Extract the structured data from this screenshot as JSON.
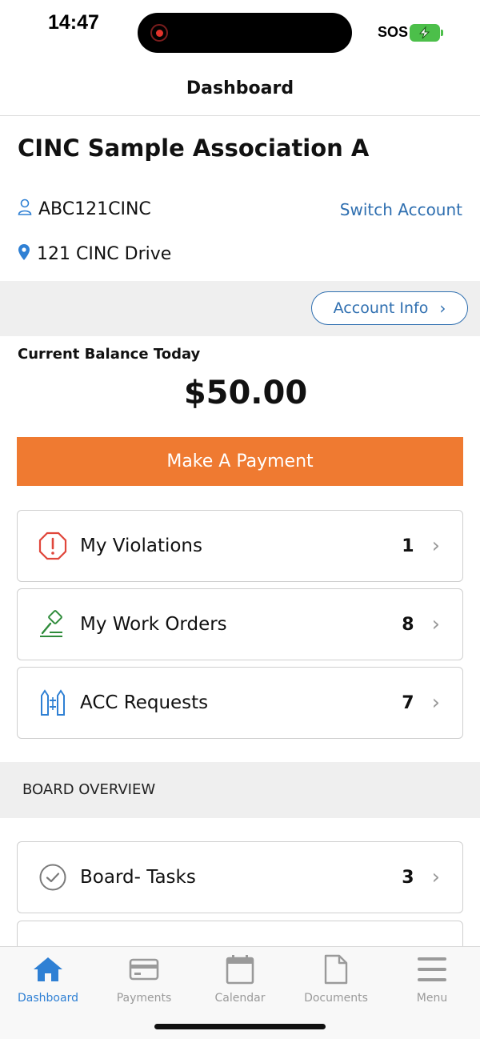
{
  "status": {
    "time": "14:47",
    "sos": "SOS"
  },
  "header": {
    "title": "Dashboard"
  },
  "association": {
    "name": "CINC Sample Association A",
    "account_id": "ABC121CINC",
    "switch_label": "Switch Account",
    "address": "121 CINC Drive",
    "account_info_label": "Account Info"
  },
  "balance": {
    "label": "Current Balance Today",
    "amount": "$50.00",
    "pay_label": "Make A Payment"
  },
  "items": [
    {
      "label": "My Violations",
      "count": "1",
      "icon": "warning-octagon-icon",
      "color": "#e0463b"
    },
    {
      "label": "My Work Orders",
      "count": "8",
      "icon": "hammer-icon",
      "color": "#2e8b3a"
    },
    {
      "label": "ACC Requests",
      "count": "7",
      "icon": "acc-icon",
      "color": "#2f80d4"
    }
  ],
  "board": {
    "title": "BOARD OVERVIEW",
    "items": [
      {
        "label": "Board- Tasks",
        "count": "3",
        "icon": "check-circle-icon"
      }
    ]
  },
  "tabs": [
    {
      "label": "Dashboard",
      "icon": "home-icon",
      "active": true
    },
    {
      "label": "Payments",
      "icon": "credit-card-icon",
      "active": false
    },
    {
      "label": "Calendar",
      "icon": "calendar-icon",
      "active": false
    },
    {
      "label": "Documents",
      "icon": "document-icon",
      "active": false
    },
    {
      "label": "Menu",
      "icon": "menu-icon",
      "active": false
    }
  ],
  "colors": {
    "accent": "#2f6fb0",
    "pay_button": "#ef7a31",
    "tab_active": "#2f80d4"
  }
}
